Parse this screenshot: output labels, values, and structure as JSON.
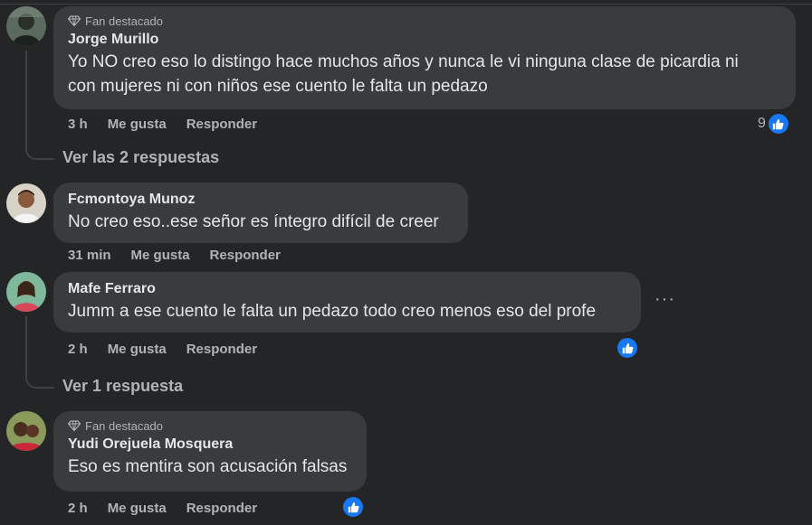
{
  "comments": [
    {
      "badge": "Fan destacado",
      "author": "Jorge Murillo",
      "text_lines": [
        "Yo NO creo eso lo distingo hace muchos años y nunca le vi ninguna clase de picardia ni",
        "con mujeres ni con niños ese cuento le falta un pedazo"
      ],
      "time": "3 h",
      "like_label": "Me gusta",
      "reply_label": "Responder",
      "reaction_count": "9",
      "view_replies": "Ver las 2 respuestas"
    },
    {
      "author": "Fcmontoya Munoz",
      "text_lines": [
        "No creo eso..ese señor es íntegro difícil de creer"
      ],
      "time": "31 min",
      "like_label": "Me gusta",
      "reply_label": "Responder"
    },
    {
      "author": "Mafe Ferraro",
      "text_lines": [
        "Jumm a ese cuento le falta un pedazo todo creo menos eso del profe"
      ],
      "time": "2 h",
      "like_label": "Me gusta",
      "reply_label": "Responder",
      "more_label": "···",
      "view_replies": "Ver 1 respuesta"
    },
    {
      "badge": "Fan destacado",
      "author": "Yudi Orejuela Mosquera",
      "text_lines": [
        "Eso es mentira son acusación falsas"
      ],
      "time": "2 h",
      "like_label": "Me gusta",
      "reply_label": "Responder"
    }
  ],
  "colors": {
    "background": "#242526",
    "bubble": "#3a3b3c",
    "like": "#1877f2",
    "muted": "#b0b3b8"
  },
  "icons": {
    "badge": "diamond-icon",
    "reaction": "thumbs-up-icon",
    "more": "more-horizontal-icon"
  }
}
